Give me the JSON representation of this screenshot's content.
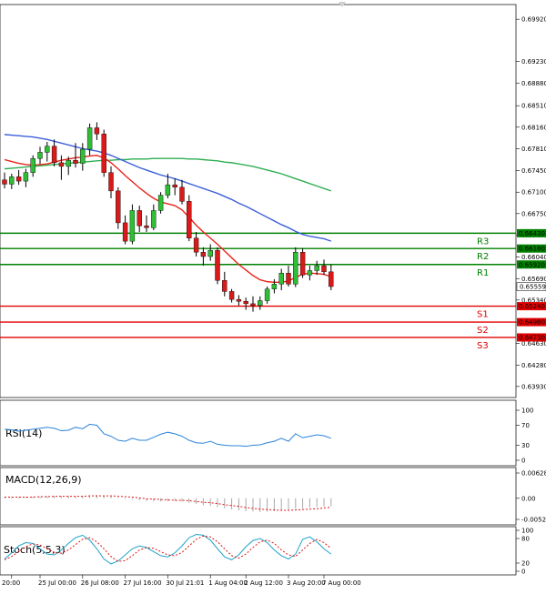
{
  "chart_data": {
    "type": "candlestick",
    "main": {
      "y_range": [
        0.6375,
        0.7016
      ],
      "y_ticks": [
        "0.69920",
        "0.69230",
        "0.68880",
        "0.68510",
        "0.68160",
        "0.67810",
        "0.67450",
        "0.67100",
        "0.66750",
        "0.66400",
        "0.66040",
        "0.65690",
        "0.65340",
        "0.64980",
        "0.64630",
        "0.64280",
        "0.63930"
      ],
      "last_price": "0.65559",
      "levels": [
        {
          "label": "R3",
          "value": 0.6643,
          "tag": "0.66430",
          "color": "#008000"
        },
        {
          "label": "R2",
          "value": 0.6618,
          "tag": "0.66180",
          "color": "#008000"
        },
        {
          "label": "R1",
          "value": 0.6592,
          "tag": "0.65920",
          "color": "#008000"
        },
        {
          "label": "S1",
          "value": 0.6524,
          "tag": "0.65240",
          "color": "#e00000"
        },
        {
          "label": "S2",
          "value": 0.6498,
          "tag": "0.64980",
          "color": "#e00000"
        },
        {
          "label": "S3",
          "value": 0.6473,
          "tag": "0.64730",
          "color": "#e00000"
        }
      ],
      "candles": [
        [
          0.673,
          0.6742,
          0.6716,
          0.6723
        ],
        [
          0.6723,
          0.674,
          0.6715,
          0.6735
        ],
        [
          0.6735,
          0.6746,
          0.6722,
          0.6728
        ],
        [
          0.6728,
          0.6748,
          0.6718,
          0.6742
        ],
        [
          0.6742,
          0.677,
          0.6735,
          0.6765
        ],
        [
          0.6765,
          0.6784,
          0.6756,
          0.6775
        ],
        [
          0.6775,
          0.6792,
          0.676,
          0.6785
        ],
        [
          0.6785,
          0.6796,
          0.6752,
          0.6758
        ],
        [
          0.6758,
          0.677,
          0.673,
          0.6752
        ],
        [
          0.6752,
          0.6768,
          0.6738,
          0.6762
        ],
        [
          0.6762,
          0.679,
          0.675,
          0.6757
        ],
        [
          0.6757,
          0.679,
          0.6745,
          0.678
        ],
        [
          0.678,
          0.6822,
          0.677,
          0.6815
        ],
        [
          0.6815,
          0.6824,
          0.6795,
          0.6805
        ],
        [
          0.6805,
          0.6812,
          0.6735,
          0.6742
        ],
        [
          0.6742,
          0.6752,
          0.67,
          0.6712
        ],
        [
          0.6712,
          0.6718,
          0.665,
          0.666
        ],
        [
          0.666,
          0.6672,
          0.6625,
          0.663
        ],
        [
          0.663,
          0.669,
          0.6625,
          0.668
        ],
        [
          0.668,
          0.6688,
          0.6645,
          0.6655
        ],
        [
          0.6655,
          0.6672,
          0.6645,
          0.6652
        ],
        [
          0.6652,
          0.669,
          0.6648,
          0.668
        ],
        [
          0.668,
          0.671,
          0.6675,
          0.6705
        ],
        [
          0.6705,
          0.674,
          0.67,
          0.6722
        ],
        [
          0.6722,
          0.6732,
          0.6705,
          0.6718
        ],
        [
          0.6718,
          0.673,
          0.669,
          0.6695
        ],
        [
          0.6695,
          0.6705,
          0.663,
          0.6635
        ],
        [
          0.6635,
          0.6645,
          0.6605,
          0.6612
        ],
        [
          0.6612,
          0.662,
          0.659,
          0.6605
        ],
        [
          0.6605,
          0.6625,
          0.6598,
          0.6615
        ],
        [
          0.6615,
          0.662,
          0.656,
          0.6566
        ],
        [
          0.6566,
          0.658,
          0.654,
          0.6548
        ],
        [
          0.6548,
          0.6552,
          0.653,
          0.6535
        ],
        [
          0.6535,
          0.6542,
          0.6525,
          0.6532
        ],
        [
          0.6532,
          0.6538,
          0.6518,
          0.6528
        ],
        [
          0.6528,
          0.654,
          0.6515,
          0.6525
        ],
        [
          0.6525,
          0.654,
          0.6518,
          0.6533
        ],
        [
          0.6533,
          0.6556,
          0.6528,
          0.6552
        ],
        [
          0.6552,
          0.6568,
          0.6545,
          0.656
        ],
        [
          0.656,
          0.6585,
          0.655,
          0.6578
        ],
        [
          0.6578,
          0.659,
          0.6556,
          0.656
        ],
        [
          0.656,
          0.662,
          0.6555,
          0.6612
        ],
        [
          0.6612,
          0.6618,
          0.657,
          0.6575
        ],
        [
          0.6575,
          0.659,
          0.6566,
          0.6582
        ],
        [
          0.6582,
          0.6598,
          0.6575,
          0.659
        ],
        [
          0.659,
          0.66,
          0.6575,
          0.658
        ],
        [
          0.658,
          0.6592,
          0.655,
          0.6556
        ]
      ],
      "ma_fast": [
        0.6763,
        0.676,
        0.6757,
        0.6755,
        0.6754,
        0.6755,
        0.6756,
        0.6759,
        0.6762,
        0.6764,
        0.6766,
        0.6767,
        0.6769,
        0.677,
        0.6766,
        0.6758,
        0.6748,
        0.6737,
        0.6727,
        0.6717,
        0.6708,
        0.67,
        0.6694,
        0.6691,
        0.6688,
        0.6681,
        0.6669,
        0.6656,
        0.6645,
        0.6635,
        0.6625,
        0.6614,
        0.6603,
        0.6592,
        0.6583,
        0.6574,
        0.6567,
        0.6564,
        0.6563,
        0.6563,
        0.6565,
        0.6571,
        0.6576,
        0.6578,
        0.6577,
        0.6576,
        0.6572
      ],
      "ma_mid": [
        0.6804,
        0.6803,
        0.6802,
        0.6801,
        0.68,
        0.6798,
        0.6796,
        0.6793,
        0.679,
        0.6787,
        0.6784,
        0.6781,
        0.6779,
        0.6777,
        0.6774,
        0.677,
        0.6765,
        0.676,
        0.6755,
        0.675,
        0.6746,
        0.6742,
        0.6738,
        0.6735,
        0.6732,
        0.6728,
        0.6724,
        0.672,
        0.6716,
        0.6712,
        0.6708,
        0.6703,
        0.6698,
        0.6692,
        0.6687,
        0.6681,
        0.6675,
        0.6669,
        0.6663,
        0.6657,
        0.6652,
        0.6646,
        0.6641,
        0.6638,
        0.6636,
        0.6634,
        0.663
      ],
      "ma_slow": [
        0.6748,
        0.6749,
        0.675,
        0.6751,
        0.6752,
        0.6753,
        0.6754,
        0.6755,
        0.6756,
        0.6757,
        0.6758,
        0.6759,
        0.676,
        0.6761,
        0.6762,
        0.6762,
        0.6763,
        0.6763,
        0.6764,
        0.6764,
        0.6764,
        0.6765,
        0.6765,
        0.6765,
        0.6765,
        0.6765,
        0.6764,
        0.6764,
        0.6763,
        0.6762,
        0.6761,
        0.6759,
        0.6758,
        0.6756,
        0.6754,
        0.6752,
        0.6749,
        0.6746,
        0.6743,
        0.674,
        0.6736,
        0.6732,
        0.6728,
        0.6724,
        0.672,
        0.6716,
        0.6712
      ]
    },
    "rsi": {
      "label": "RSI(14)",
      "y_ticks": [
        {
          "label": "100",
          "value": 100
        },
        {
          "label": "70",
          "value": 70
        },
        {
          "label": "30",
          "value": 30
        },
        {
          "label": "0",
          "value": 0
        }
      ],
      "values": [
        62,
        61,
        58,
        60,
        62,
        64,
        66,
        64,
        59,
        60,
        66,
        63,
        72,
        70,
        53,
        48,
        40,
        38,
        44,
        40,
        40,
        46,
        52,
        56,
        53,
        48,
        40,
        35,
        34,
        38,
        32,
        30,
        29,
        29,
        28,
        30,
        31,
        35,
        38,
        44,
        38,
        53,
        45,
        48,
        51,
        49,
        44
      ]
    },
    "macd": {
      "label": "MACD(12,26,9)",
      "y_ticks": [
        {
          "label": "0.006286",
          "value": 0.006286
        },
        {
          "label": "0.00",
          "value": 0
        },
        {
          "label": "-0.005248",
          "value": -0.005248
        }
      ],
      "histogram": [
        0.0003,
        0.0003,
        0.0003,
        0.0003,
        0.0004,
        0.0005,
        0.0006,
        0.0006,
        0.0006,
        0.0006,
        0.0006,
        0.0006,
        0.0007,
        0.0008,
        0.0007,
        0.0005,
        0.0002,
        -0.0002,
        -0.0003,
        -0.0005,
        -0.0007,
        -0.0008,
        -0.0008,
        -0.0007,
        -0.0007,
        -0.0008,
        -0.0011,
        -0.0014,
        -0.0017,
        -0.0019,
        -0.0022,
        -0.0025,
        -0.0028,
        -0.003,
        -0.0032,
        -0.0033,
        -0.0034,
        -0.0033,
        -0.0032,
        -0.003,
        -0.0029,
        -0.0026,
        -0.0025,
        -0.0023,
        -0.0021,
        -0.002,
        -0.002
      ],
      "signal": [
        0.0003,
        0.0003,
        0.0003,
        0.0003,
        0.0003,
        0.0004,
        0.0004,
        0.0005,
        0.0005,
        0.0005,
        0.0005,
        0.0005,
        0.0006,
        0.0006,
        0.0006,
        0.0006,
        0.0005,
        0.0004,
        0.0003,
        0.0001,
        -0.0001,
        -0.0002,
        -0.0003,
        -0.0004,
        -0.0005,
        -0.0005,
        -0.0006,
        -0.0008,
        -0.001,
        -0.0011,
        -0.0013,
        -0.0016,
        -0.0018,
        -0.002,
        -0.0023,
        -0.0025,
        -0.0027,
        -0.0028,
        -0.0029,
        -0.003,
        -0.003,
        -0.0029,
        -0.0028,
        -0.0027,
        -0.0026,
        -0.0024,
        -0.0022
      ]
    },
    "stoch": {
      "label": "Stoch(5,5,3)",
      "y_ticks": [
        {
          "label": "100",
          "value": 100
        },
        {
          "label": "80",
          "value": 80
        },
        {
          "label": "20",
          "value": 20
        },
        {
          "label": "0",
          "value": 0
        }
      ],
      "main": [
        30,
        45,
        62,
        70,
        68,
        55,
        42,
        40,
        52,
        68,
        82,
        88,
        76,
        55,
        30,
        18,
        25,
        40,
        55,
        62,
        58,
        48,
        38,
        35,
        45,
        62,
        82,
        90,
        88,
        76,
        55,
        35,
        28,
        40,
        60,
        75,
        80,
        70,
        52,
        38,
        30,
        42,
        78,
        84,
        72,
        55,
        42
      ],
      "signal": [
        28,
        36,
        48,
        60,
        67,
        64,
        55,
        46,
        44,
        52,
        65,
        78,
        82,
        72,
        55,
        36,
        24,
        26,
        38,
        52,
        58,
        56,
        48,
        40,
        38,
        46,
        62,
        78,
        86,
        84,
        72,
        55,
        38,
        32,
        42,
        58,
        72,
        76,
        68,
        52,
        40,
        36,
        52,
        68,
        78,
        70,
        56
      ]
    },
    "x_ticks": [
      {
        "label": "20:00",
        "index": 1
      },
      {
        "label": "25 Jul 00:00",
        "index": 5
      },
      {
        "label": "26 Jul 08:00",
        "index": 11
      },
      {
        "label": "27 Jul 16:00",
        "index": 17
      },
      {
        "label": "30 Jul 21:01",
        "index": 23
      },
      {
        "label": "1 Aug 04:00",
        "index": 29
      },
      {
        "label": "2 Aug 12:00",
        "index": 34
      },
      {
        "label": "3 Aug 20:00",
        "index": 40
      },
      {
        "label": "7 Aug 00:00",
        "index": 45
      }
    ]
  }
}
